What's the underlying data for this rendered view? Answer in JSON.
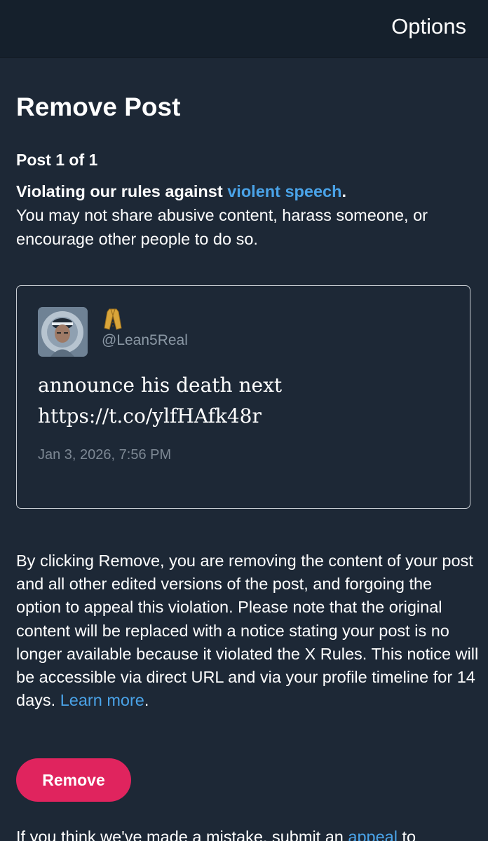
{
  "header": {
    "options_label": "Options"
  },
  "page": {
    "title": "Remove Post",
    "post_count": "Post 1 of 1",
    "violation_prefix": "Violating our rules against ",
    "violation_link": "violent speech",
    "violation_suffix": ".",
    "violation_description": "You may not share abusive content, harass someone, or encourage other people to do so."
  },
  "post": {
    "author_emoji": "🧥",
    "handle": "@Lean5Real",
    "text_line1": "announce his death next",
    "text_line2": "https://t.co/ylfHAfk48r",
    "timestamp": "Jan 3, 2026, 7:56 PM"
  },
  "disclaimer": {
    "text": "By clicking Remove, you are removing the content of your post and all other edited versions of the post, and forgoing the option to appeal this violation. Please note that the original content will be replaced with a notice stating your post is no longer available because it violated the X Rules. This notice will be accessible via direct URL and via your profile timeline for 14 days. ",
    "learn_more": "Learn more",
    "suffix": "."
  },
  "actions": {
    "remove_label": "Remove"
  },
  "footer": {
    "prefix": "If you think we've made a mistake, submit an ",
    "appeal_link": "appeal",
    "suffix": " to"
  },
  "colors": {
    "background": "#1d2836",
    "header_background": "#15202c",
    "link": "#4aa3e8",
    "remove_button": "#e0245e",
    "muted_text": "#8b98a5"
  }
}
